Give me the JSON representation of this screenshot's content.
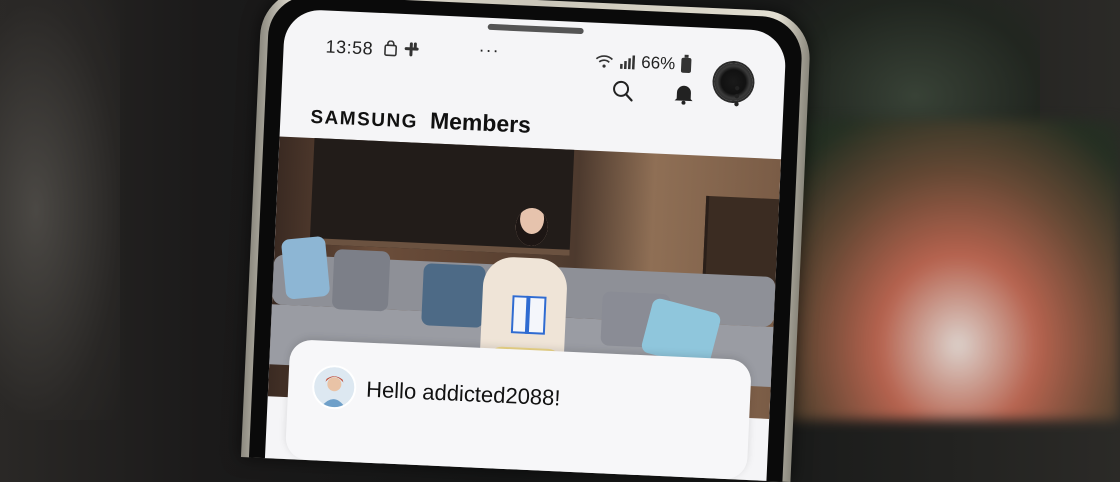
{
  "status_bar": {
    "time": "13:58",
    "notification_icons": [
      "shopping-bag-icon",
      "slack-icon"
    ],
    "overflow_dots": "···",
    "battery_percent": "66%",
    "wifi_icon": "wifi-icon",
    "signal_icon": "signal-icon"
  },
  "header": {
    "brand_samsung": "SAMSUNG",
    "brand_members": "Members",
    "actions": [
      "search-icon",
      "bell-icon",
      "more-vert-icon"
    ]
  },
  "banner": {
    "image_subject": "banner-image"
  },
  "welcome_card": {
    "greeting": "Hello addicted2088!"
  },
  "colors": {
    "screen_bg": "#f5f5f7",
    "text": "#111111",
    "accent_blue": "#2f6bd1"
  }
}
